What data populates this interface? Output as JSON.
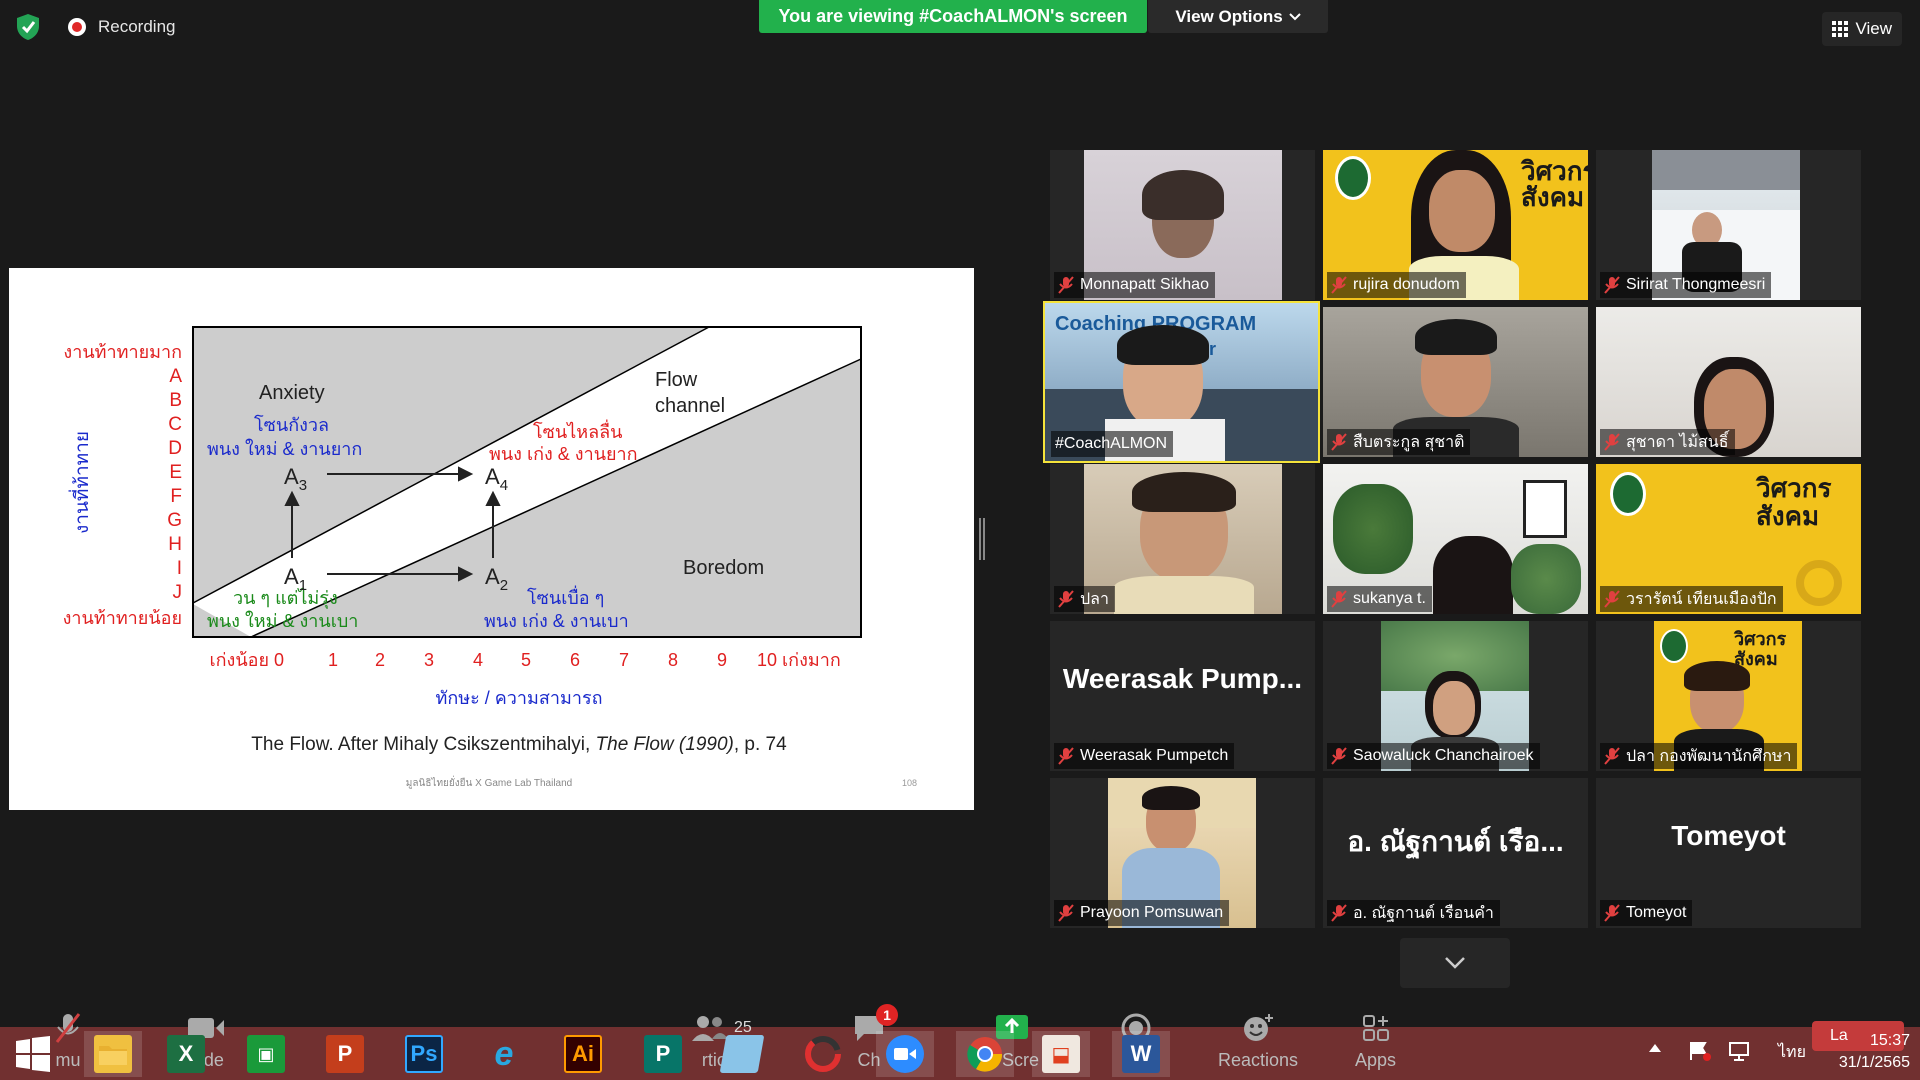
{
  "top": {
    "recording_label": "Recording",
    "banner": "You are viewing #CoachALMON's screen",
    "view_options": "View Options",
    "view_label": "View"
  },
  "slide": {
    "left_labels": [
      "งานท้าทายมาก",
      "A",
      "B",
      "C",
      "D",
      "E",
      "F",
      "G",
      "H",
      "I",
      "J",
      "งานท้าทายน้อย"
    ],
    "y_axis_label": "งานที่ท้าทาย",
    "x_ticks": [
      "เก่งน้อย 0",
      "1",
      "2",
      "3",
      "4",
      "5",
      "6",
      "7",
      "8",
      "9",
      "10 เก่งมาก"
    ],
    "x_axis_label": "ทักษะ / ความสามารถ",
    "anxiety": "Anxiety",
    "anxiety_th_1": "โซนกังวล",
    "anxiety_th_2": "พนง ใหม่ & งานยาก",
    "flow_1": "Flow",
    "flow_2": "channel",
    "flow_th_1": "โซนไหลลื่น",
    "flow_th_2": "พนง เก่ง & งานยาก",
    "boredom": "Boredom",
    "bored_th_1": "โซนเบื่อ ๆ",
    "bored_th_2": "พนง เก่ง & งานเบา",
    "a1_th_1": "วน ๆ แต่ไม่รุ่ง",
    "a1_th_2": "พนง ใหม่ & งานเบา",
    "a1": "A",
    "a1_sub": "1",
    "a2": "A",
    "a2_sub": "2",
    "a3": "A",
    "a3_sub": "3",
    "a4": "A",
    "a4_sub": "4",
    "citation_prefix": "The Flow.  After Mihaly Csikszentmihalyi, ",
    "citation_italic": "The Flow (1990)",
    "citation_suffix": ", p. 74",
    "footer": "มูลนิธิไทยยั่งยืน X Game Lab Thailand",
    "page_num": "108"
  },
  "gallery": [
    {
      "name": "Monnapatt Sikhao",
      "muted": true,
      "big": ""
    },
    {
      "name": "rujira donudom",
      "muted": true,
      "big": ""
    },
    {
      "name": "Sirirat Thongmeesri",
      "muted": true,
      "big": ""
    },
    {
      "name": "#CoachALMON",
      "muted": false,
      "big": "",
      "overlay": "Coaching PROGRAM",
      "overlay2": "turer"
    },
    {
      "name": "สืบตระกูล สุชาติ",
      "muted": true,
      "big": ""
    },
    {
      "name": "สุชาดา ไม้สนธิ์",
      "muted": true,
      "big": ""
    },
    {
      "name": "ปลา",
      "muted": true,
      "big": ""
    },
    {
      "name": "sukanya t.",
      "muted": true,
      "big": ""
    },
    {
      "name": "วรารัตน์ เทียนเมืองปัก",
      "muted": true,
      "big": ""
    },
    {
      "name": "Weerasak Pumpetch",
      "muted": true,
      "big": "Weerasak  Pump..."
    },
    {
      "name": "Saowaluck Chanchairoek",
      "muted": true,
      "big": ""
    },
    {
      "name": "ปลา กองพัฒนานักศึกษา",
      "muted": true,
      "big": ""
    },
    {
      "name": "Prayoon Pomsuwan",
      "muted": true,
      "big": ""
    },
    {
      "name": "อ. ณัฐกานต์  เรือนคำ",
      "muted": true,
      "big": "อ. ณัฐกานต์  เรือ..."
    },
    {
      "name": "Tomeyot",
      "muted": true,
      "big": "Tomeyot"
    }
  ],
  "poster_text": "วิศวกร สังคม",
  "controls": {
    "participants_count": "25",
    "chat_badge": "1",
    "reactions": "Reactions",
    "apps": "Apps",
    "partial_labels": [
      "mu",
      "Vide",
      "rticip",
      "Ch",
      "S",
      "Scre",
      "R"
    ]
  },
  "taskbar": {
    "apps": [
      "windows-start",
      "file-explorer",
      "excel",
      "store",
      "powerpoint",
      "photoshop",
      "internet-explorer",
      "illustrator",
      "publisher",
      "notepad",
      "photoscape",
      "zoom",
      "chrome",
      "paint",
      "word"
    ],
    "lang": "ไทย",
    "time": "15:37",
    "date": "31/1/2565",
    "lang_popup": "La"
  },
  "colors": {
    "banner": "#22b14c",
    "active_speaker": "#f5e33b",
    "slide_red": "#e02020",
    "slide_blue": "#1a2acc",
    "slide_green": "#1a8a1a",
    "poster_yellow": "#f2c21c"
  }
}
